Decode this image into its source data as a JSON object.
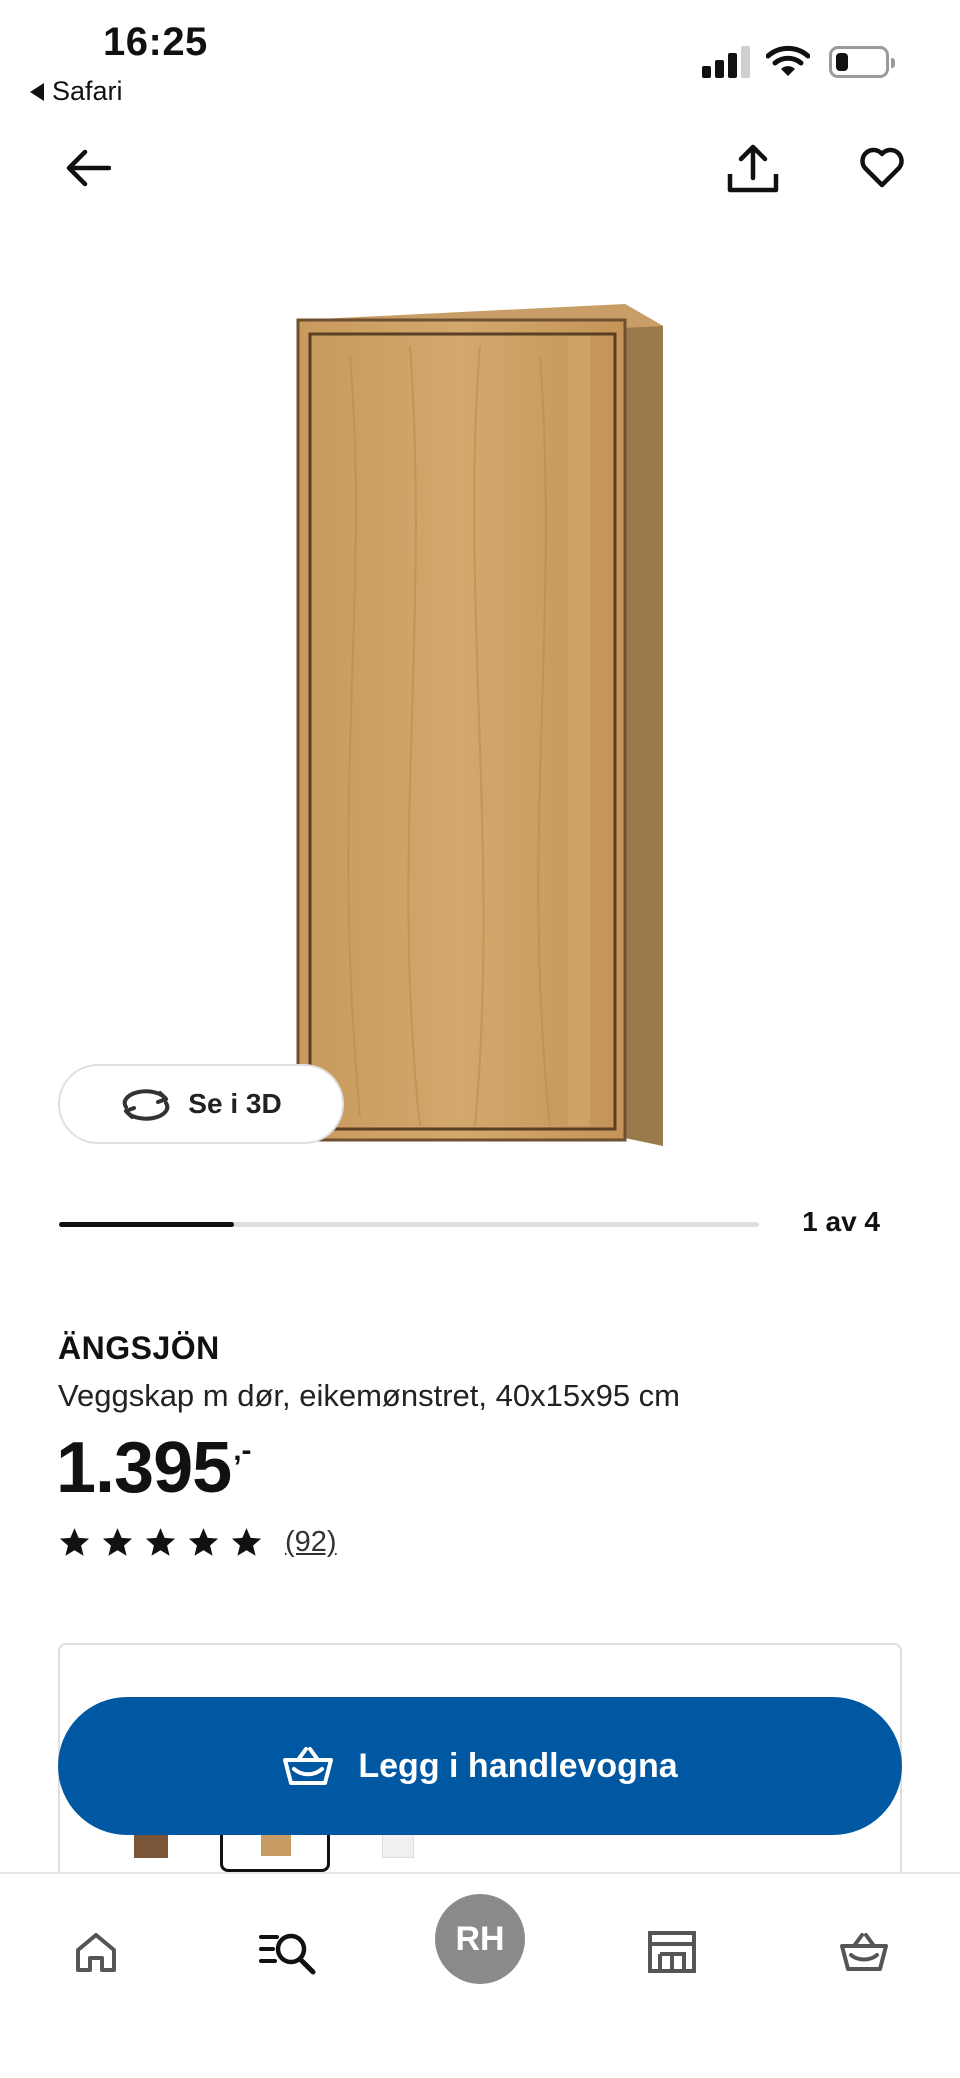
{
  "status_bar": {
    "time": "16:25",
    "back_app": "Safari"
  },
  "top_bar": {
    "back_icon": "arrow-left-icon",
    "share_icon": "share-icon",
    "favourite_icon": "heart-icon"
  },
  "gallery": {
    "view_3d_label": "Se i 3D",
    "pager_label": "1 av 4",
    "current": 1,
    "total": 4
  },
  "product": {
    "name": "ÄNGSJÖN",
    "description": "Veggskap m dør, eikemønstret, 40x15x95 cm",
    "price": "1.395",
    "price_suffix": ",-",
    "rating_stars": 5,
    "review_count": "(92)"
  },
  "cart_button": {
    "label": "Legg i handlevogna"
  },
  "variants": {
    "colors": [
      "#7a5538",
      "#c69b64",
      "#f0f0f0"
    ],
    "selected_index": 1
  },
  "bottom_nav": {
    "profile_initials": "RH"
  },
  "colors": {
    "accent": "#0058a3",
    "wood": "#c69b64"
  }
}
